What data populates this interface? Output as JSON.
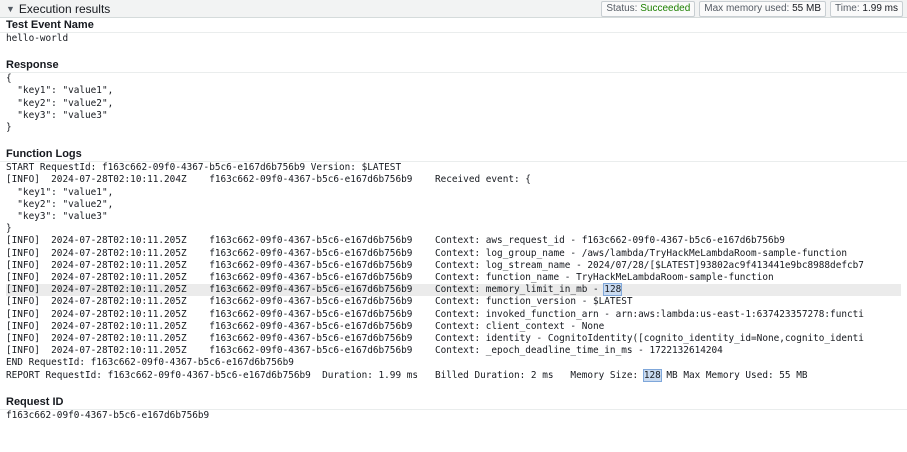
{
  "header": {
    "title": "Execution results",
    "status_label": "Status:",
    "status_value": "Succeeded",
    "memory_label": "Max memory used:",
    "memory_value": "55 MB",
    "time_label": "Time:",
    "time_value": "1.99 ms"
  },
  "test_event": {
    "title": "Test Event Name",
    "value": "hello-world"
  },
  "response": {
    "title": "Response",
    "lines": [
      "{",
      "  \"key1\": \"value1\",",
      "  \"key2\": \"value2\",",
      "  \"key3\": \"value3\"",
      "}"
    ]
  },
  "function_logs": {
    "title": "Function Logs",
    "lines": [
      "START RequestId: f163c662-09f0-4367-b5c6-e167d6b756b9 Version: $LATEST",
      "[INFO]  2024-07-28T02:10:11.204Z    f163c662-09f0-4367-b5c6-e167d6b756b9    Received event: {",
      "  \"key1\": \"value1\",",
      "  \"key2\": \"value2\",",
      "  \"key3\": \"value3\"",
      "}",
      "[INFO]  2024-07-28T02:10:11.205Z    f163c662-09f0-4367-b5c6-e167d6b756b9    Context: aws_request_id - f163c662-09f0-4367-b5c6-e167d6b756b9",
      "[INFO]  2024-07-28T02:10:11.205Z    f163c662-09f0-4367-b5c6-e167d6b756b9    Context: log_group_name - /aws/lambda/TryHackMeLambdaRoom-sample-function",
      "[INFO]  2024-07-28T02:10:11.205Z    f163c662-09f0-4367-b5c6-e167d6b756b9    Context: log_stream_name - 2024/07/28/[$LATEST]93802ac9f413441e9bc8988defcb7",
      "[INFO]  2024-07-28T02:10:11.205Z    f163c662-09f0-4367-b5c6-e167d6b756b9    Context: function_name - TryHackMeLambdaRoom-sample-function",
      "[INFO]  2024-07-28T02:10:11.205Z    f163c662-09f0-4367-b5c6-e167d6b756b9    Context: memory_limit_in_mb - ",
      "[INFO]  2024-07-28T02:10:11.205Z    f163c662-09f0-4367-b5c6-e167d6b756b9    Context: function_version - $LATEST",
      "[INFO]  2024-07-28T02:10:11.205Z    f163c662-09f0-4367-b5c6-e167d6b756b9    Context: invoked_function_arn - arn:aws:lambda:us-east-1:637423357278:functi",
      "[INFO]  2024-07-28T02:10:11.205Z    f163c662-09f0-4367-b5c6-e167d6b756b9    Context: client_context - None",
      "[INFO]  2024-07-28T02:10:11.205Z    f163c662-09f0-4367-b5c6-e167d6b756b9    Context: identity - CognitoIdentity([cognito_identity_id=None,cognito_identi",
      "[INFO]  2024-07-28T02:10:11.205Z    f163c662-09f0-4367-b5c6-e167d6b756b9    Context: _epoch_deadline_time_in_ms - 1722132614204",
      "END RequestId: f163c662-09f0-4367-b5c6-e167d6b756b9"
    ],
    "highlight_value": "128",
    "report_prefix": "REPORT RequestId: f163c662-09f0-4367-b5c6-e167d6b756b9  Duration: 1.99 ms   Billed Duration: 2 ms   Memory Size: ",
    "report_selected": "128",
    "report_suffix": " MB Max Memory Used: 55 MB"
  },
  "request_id": {
    "title": "Request ID",
    "value": "f163c662-09f0-4367-b5c6-e167d6b756b9"
  },
  "colors": {
    "success": "#1d8102",
    "header_bg": "#f2f3f3",
    "selection": "#c9daf0"
  }
}
